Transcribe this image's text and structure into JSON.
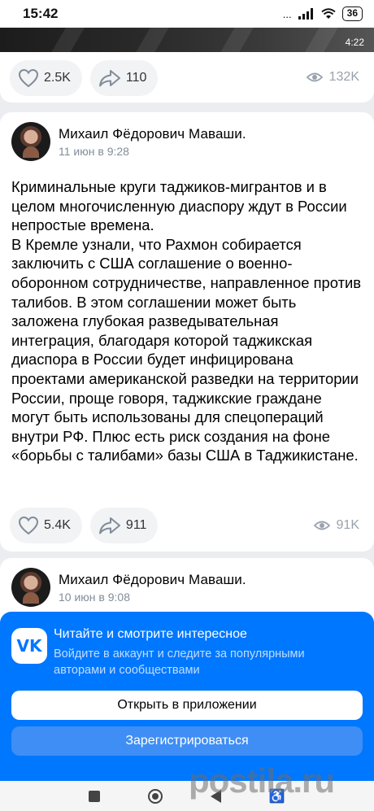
{
  "status_bar": {
    "time": "15:42",
    "battery": "36",
    "network": "...",
    "signal_icon": "signal-bars-icon",
    "wifi_icon": "wifi-icon"
  },
  "video": {
    "duration": "4:22"
  },
  "post1": {
    "likes": "2.5K",
    "shares": "110",
    "views": "132K"
  },
  "post2": {
    "author": "Михаил Фёдорович Маваши.",
    "date": "11 июн в 9:28",
    "text": "Криминальные круги таджиков-мигрантов и в целом многочисленную диаспору ждут в России непростые времена.\nВ Кремле узнали, что Рахмон собирается заключить с США соглашение о военно-оборонном сотрудничестве, направленное против талибов. В этом соглашении может быть заложена глубокая разведывательная интеграция, благодаря которой таджикская диаспора в России будет инфицирована проектами американской разведки на территории России, проще говоря, таджикские граждане могут быть использованы для спецопераций внутри РФ. Плюс есть риск создания на фоне «борьбы с талибами» базы США в Таджикистане.",
    "likes": "5.4K",
    "shares": "911",
    "views": "91K"
  },
  "post3": {
    "author": "Михаил Фёдорович Маваши.",
    "date": "10 июн в 9:08"
  },
  "sheet": {
    "logo": "VK",
    "title": "Читайте и смотрите интересное",
    "subtitle": "Войдите в аккаунт и следите за популярными авторами и сообществами",
    "open_app": "Открыть в приложении",
    "register": "Зарегистрироваться"
  },
  "watermark": "postila.ru",
  "colors": {
    "vk_blue": "#0077ff",
    "muted": "#818c99",
    "background": "#ebedf0"
  }
}
